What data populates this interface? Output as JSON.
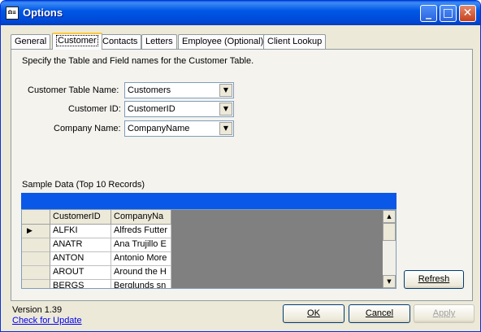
{
  "window": {
    "title": "Options",
    "icon_text": "Ω≡",
    "controls": {
      "minimize": "_",
      "maximize": "□",
      "close": "✕"
    }
  },
  "tabs": [
    {
      "label": "General",
      "active": false
    },
    {
      "label": "Customer",
      "active": true
    },
    {
      "label": "Contacts",
      "active": false
    },
    {
      "label": "Letters",
      "active": false
    },
    {
      "label": "Employee (Optional)",
      "active": false
    },
    {
      "label": "Client Lookup",
      "active": false
    }
  ],
  "panel": {
    "instructions": "Specify the Table and Field names for the Customer Table.",
    "fields": {
      "table_label": "Customer Table Name:",
      "table_value": "Customers",
      "id_label": "Customer ID:",
      "id_value": "CustomerID",
      "company_label": "Company Name:",
      "company_value": "CompanyName"
    },
    "sample_label": "Sample Data (Top 10 Records)",
    "grid": {
      "columns": [
        "CustomerID",
        "CompanyNa"
      ],
      "row_pointer": "▶",
      "rows": [
        [
          "ALFKI",
          "Alfreds Futter"
        ],
        [
          "ANATR",
          "Ana Trujillo E"
        ],
        [
          "ANTON",
          "Antonio More"
        ],
        [
          "AROUT",
          "Around the H"
        ],
        [
          "BERGS",
          "Berglunds sn"
        ]
      ]
    },
    "refresh_label": "Refresh"
  },
  "footer": {
    "version": "Version 1.39",
    "update_link": "Check for Update",
    "ok_label": "OK",
    "cancel_label": "Cancel",
    "apply_label": "Apply"
  },
  "colors": {
    "title_bar": "#0058e6",
    "grid_caption": "#0a58e8",
    "dialog_face": "#ece9d8",
    "link": "#0000ee"
  }
}
